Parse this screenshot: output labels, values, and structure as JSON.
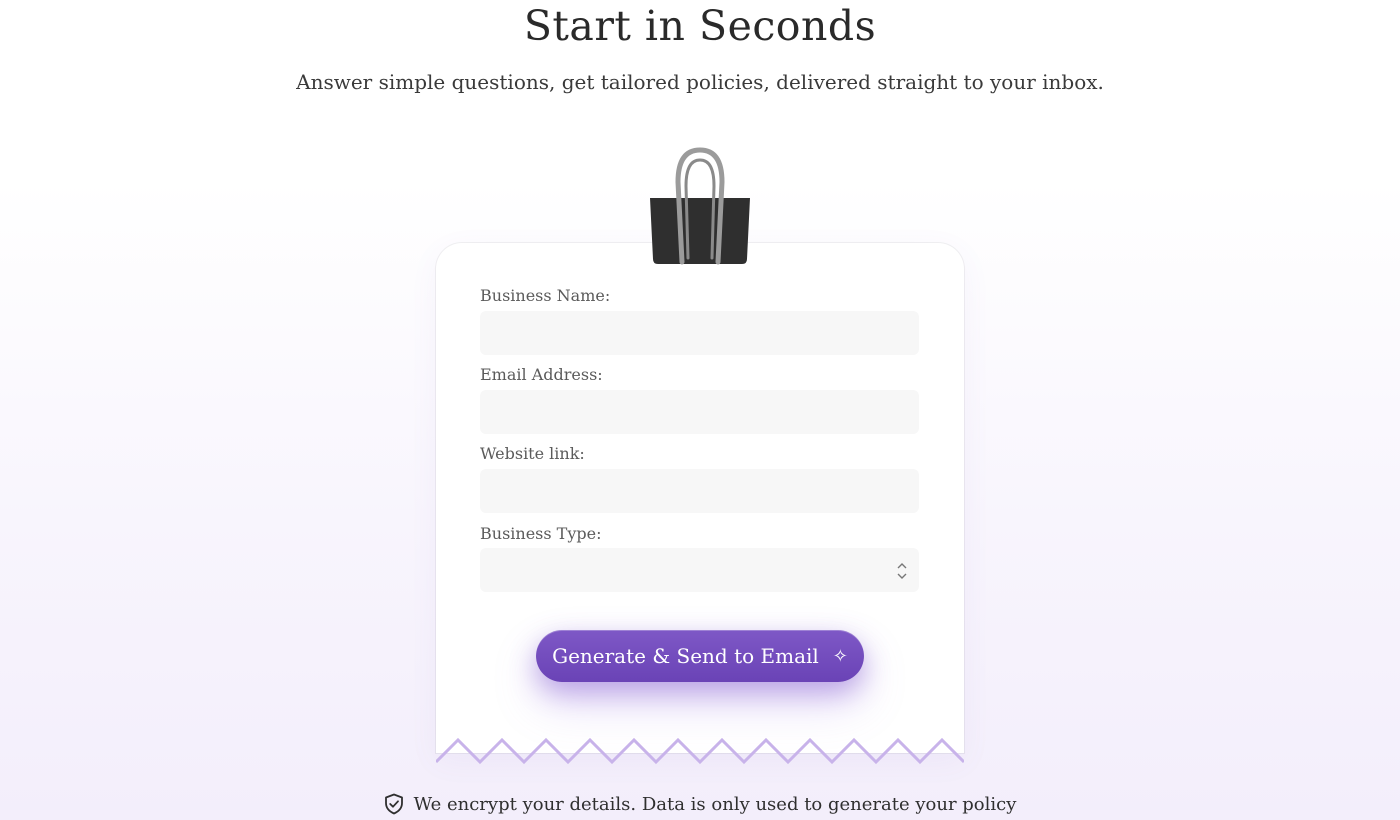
{
  "header": {
    "title": "Start in Seconds",
    "subtitle": "Answer simple questions, get tailored policies, delivered straight to your inbox."
  },
  "form": {
    "fields": [
      {
        "label": "Business Name:",
        "value": "",
        "type": "text"
      },
      {
        "label": "Email Address:",
        "value": "",
        "type": "email"
      },
      {
        "label": "Website link:",
        "value": "",
        "type": "url"
      },
      {
        "label": "Business Type:",
        "value": "",
        "type": "select"
      }
    ],
    "submit_label": "Generate & Send to Email",
    "submit_icon": "sparkle-icon"
  },
  "footer": {
    "note": "We encrypt your details. Data is only used to generate your policy",
    "icon": "shield-check-icon"
  },
  "colors": {
    "accent": "#7150bd",
    "zigzag": "#c8b3ea",
    "clip": "#2f2f2f"
  }
}
